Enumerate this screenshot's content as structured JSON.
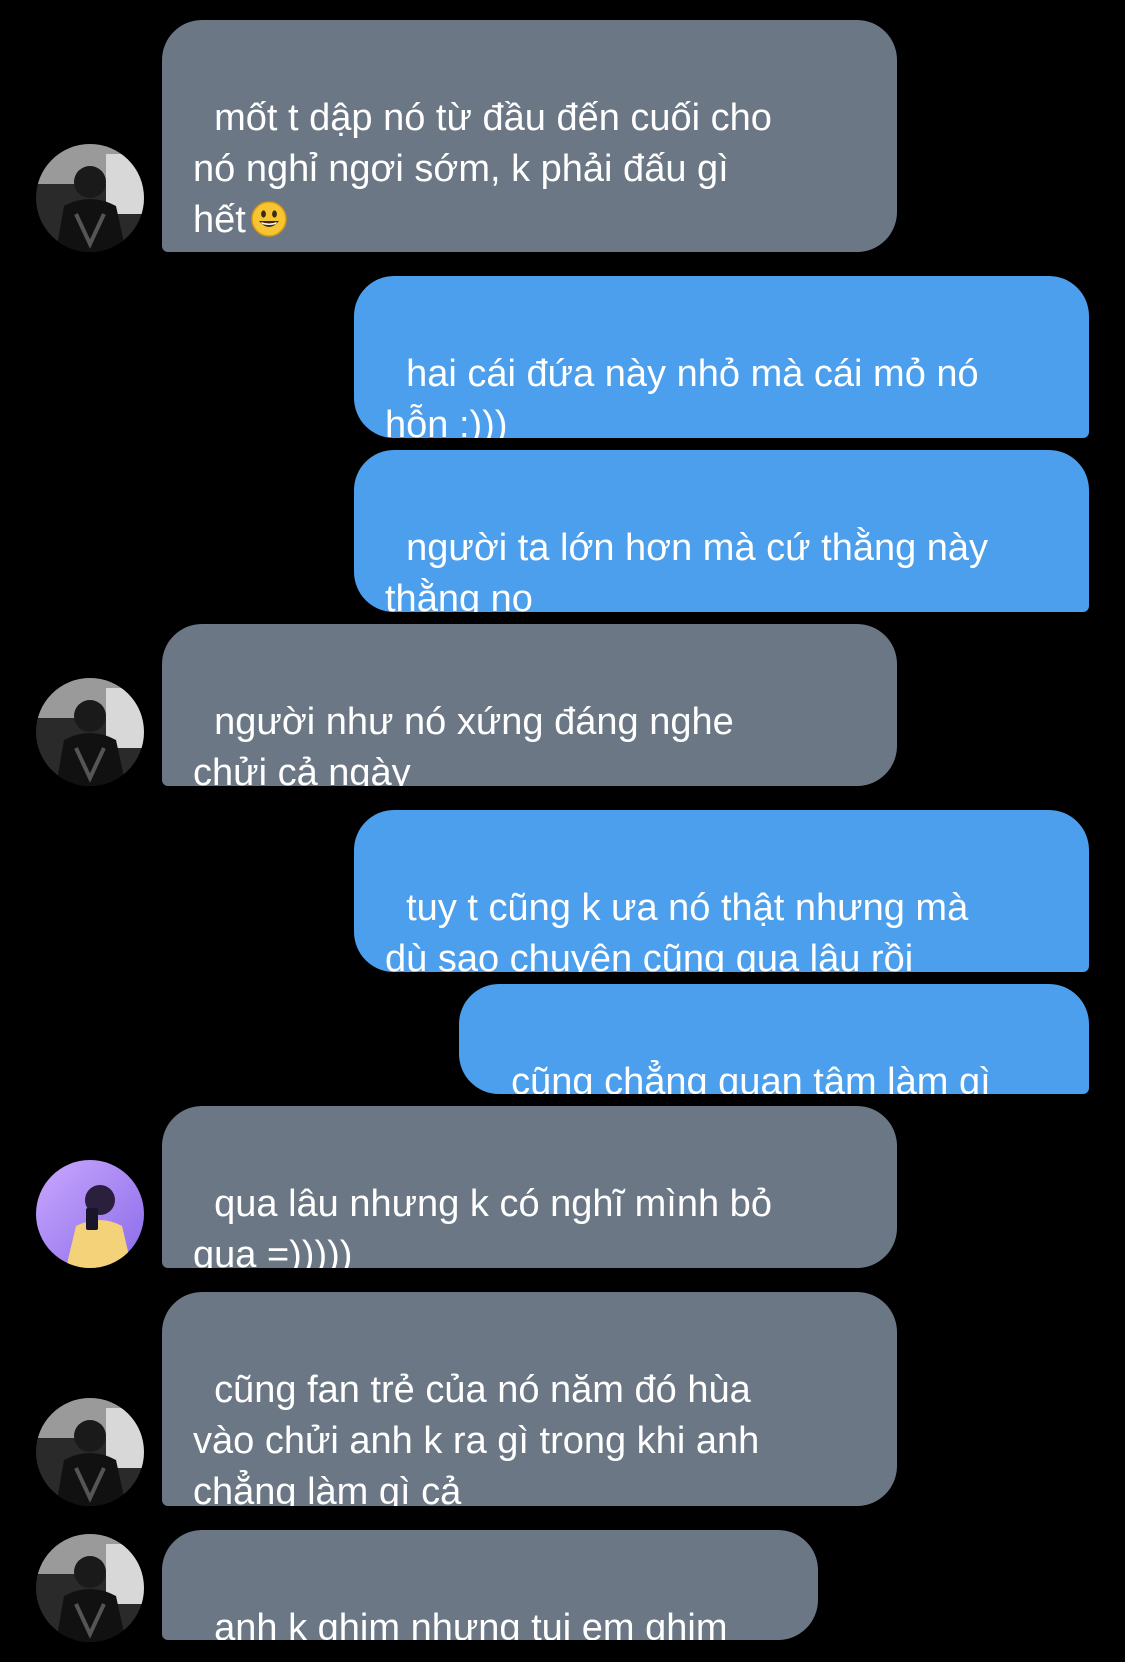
{
  "chat": {
    "messages": [
      {
        "sender": "other",
        "text": "mốt t dập nó từ đầu đến cuối cho\nnó nghỉ ngơi sớm, k phải đấu gì\nhết",
        "emoji": "grinning-face-emoji"
      },
      {
        "sender": "me",
        "text": "hai cái đứa này nhỏ mà cái mỏ nó\nhỗn :)))"
      },
      {
        "sender": "me",
        "text": "người ta lớn hơn mà cứ thằng này\nthằng nọ"
      },
      {
        "sender": "other",
        "text": "người như nó xứng đáng nghe\nchửi cả ngày"
      },
      {
        "sender": "me",
        "text": "tuy t cũng k ưa nó thật nhưng mà\ndù sao chuyện cũng qua lâu rồi"
      },
      {
        "sender": "me",
        "text": "cũng chẳng quan tâm làm gì"
      },
      {
        "sender": "other-2",
        "text": "qua lâu nhưng k có nghĩ mình bỏ\nqua =)))))"
      },
      {
        "sender": "other",
        "text": "cũng fan trẻ của nó năm đó hùa\nvào chửi anh k ra gì trong khi anh\nchẳng làm gì cả"
      },
      {
        "sender": "other",
        "text": "anh k ghim nhưng tụi em ghim"
      }
    ]
  },
  "colors": {
    "background": "#000000",
    "received_bubble": "#6b7784",
    "sent_bubble": "#4b9fec",
    "text": "#ffffff"
  }
}
